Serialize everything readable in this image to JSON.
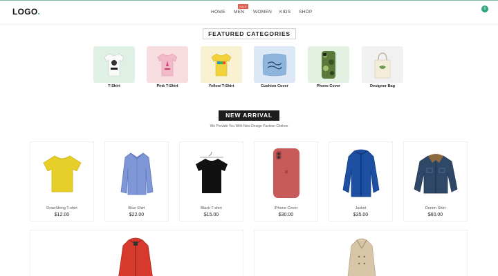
{
  "header": {
    "logo_text": "LOGO",
    "logo_dot": ".",
    "nav": [
      {
        "label": "HOME"
      },
      {
        "label": "MEN"
      },
      {
        "label": "WOMEN"
      },
      {
        "label": "KIDS"
      },
      {
        "label": "SHOP"
      }
    ],
    "sale_badge": "SALE",
    "cart_count": "0"
  },
  "featured": {
    "title": "FEATURED CATEGORIES",
    "items": [
      {
        "label": "T-Shirt",
        "bg": "#dff1e4"
      },
      {
        "label": "Pink T-Shirt",
        "bg": "#f7dde0"
      },
      {
        "label": "Yellow T-Shirt",
        "bg": "#f8f1d2"
      },
      {
        "label": "Cushion Cover",
        "bg": "#dce8f6"
      },
      {
        "label": "Phone Cover",
        "bg": "#e3f1e3"
      },
      {
        "label": "Designer Bag",
        "bg": "#f1f1f1"
      }
    ]
  },
  "arrival": {
    "title": "NEW ARRIVAL",
    "subtitle": "We Provide You With New Design Fashion Clothes",
    "products": [
      {
        "name": "DrawString T-shirt",
        "price": "$12.00"
      },
      {
        "name": "Blue Shirt",
        "price": "$22.00"
      },
      {
        "name": "Black T-shirt",
        "price": "$15.00"
      },
      {
        "name": "iPhone Cover",
        "price": "$30.00"
      },
      {
        "name": "Jacket",
        "price": "$35.00"
      },
      {
        "name": "Denim Shirt",
        "price": "$60.00"
      }
    ]
  },
  "colors": {
    "accent": "#2aa67a",
    "sale": "#e05b4b",
    "dark": "#1d1d1d"
  }
}
